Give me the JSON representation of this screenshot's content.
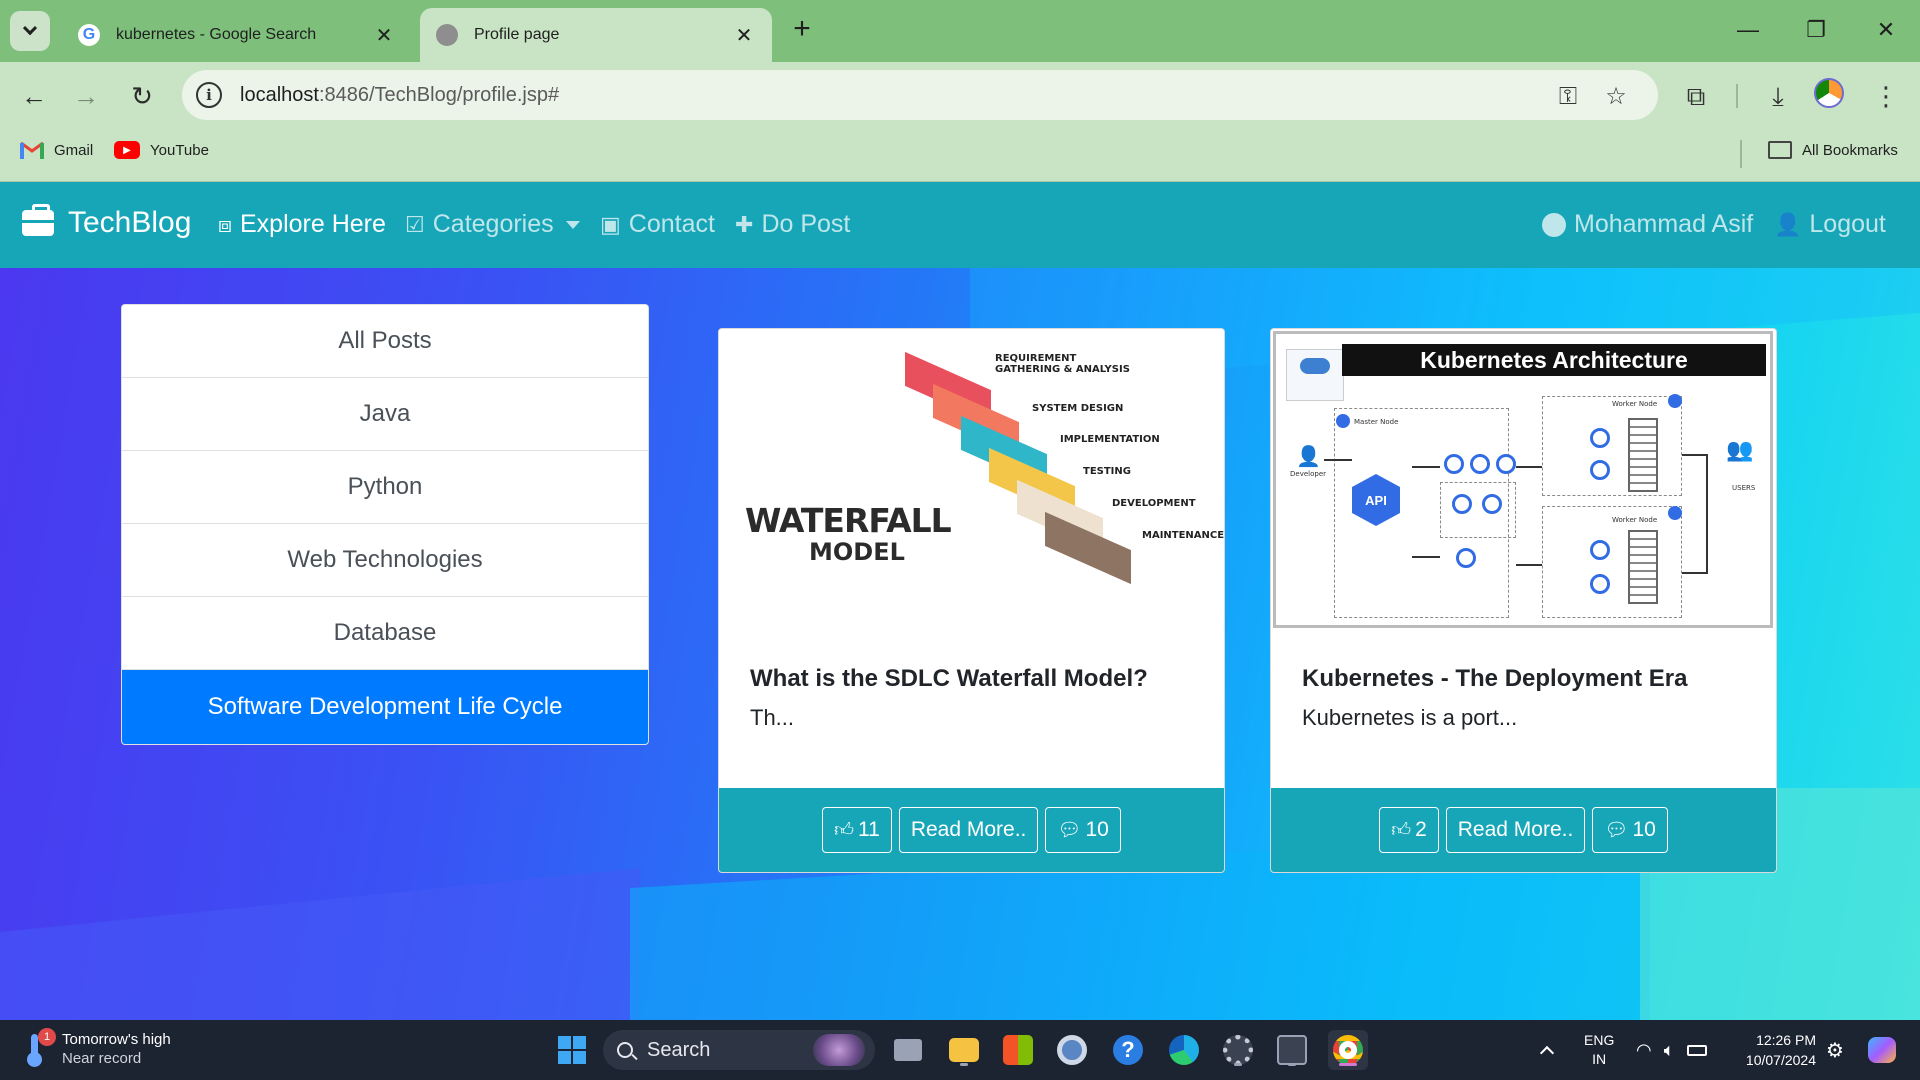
{
  "browser": {
    "tabs": [
      {
        "title": "kubernetes - Google Search",
        "favicon": "google-icon",
        "active": false
      },
      {
        "title": "Profile page",
        "favicon": "globe-icon",
        "active": true
      }
    ],
    "url_host": "localhost",
    "url_rest": ":8486/TechBlog/profile.jsp#",
    "bookmarks": [
      {
        "label": "Gmail",
        "icon": "gmail-icon"
      },
      {
        "label": "YouTube",
        "icon": "youtube-icon"
      }
    ],
    "all_bookmarks_label": "All Bookmarks"
  },
  "navbar": {
    "brand": "TechBlog",
    "items": [
      {
        "label": "Explore Here",
        "icon": "play-square-icon"
      },
      {
        "label": "Categories",
        "icon": "check-square-icon"
      },
      {
        "label": "Contact",
        "icon": "contact-book-icon"
      },
      {
        "label": "Do Post",
        "icon": "plus-icon"
      }
    ],
    "user": "Mohammad Asif",
    "logout": "Logout"
  },
  "categories": {
    "items": [
      "All Posts",
      "Java",
      "Python",
      "Web Technologies",
      "Database",
      "Software Development Life Cycle"
    ],
    "active_index": 5
  },
  "posts": [
    {
      "title": "What is the SDLC Waterfall Model?",
      "excerpt": "Th...",
      "likes": "11",
      "read_more": "Read More..",
      "comments": "10",
      "image": {
        "heading_line1": "WATERFALL",
        "heading_line2": "MODEL",
        "steps": [
          "REQUIREMENT GATHERING & ANALYSIS",
          "SYSTEM DESIGN",
          "IMPLEMENTATION",
          "TESTING",
          "DEVELOPMENT",
          "MAINTENANCE"
        ],
        "step_colors": [
          "#e9505e",
          "#f2795f",
          "#2fb6c8",
          "#f3c64a",
          "#efe1cf",
          "#8d7463"
        ]
      }
    },
    {
      "title": "Kubernetes - The Deployment Era",
      "excerpt": "Kubernetes is a port...",
      "likes": "2",
      "read_more": "Read More..",
      "comments": "10",
      "image": {
        "heading": "Kubernetes Architecture",
        "api_label": "API",
        "developer_label": "Developer",
        "users_label": "USERS",
        "master_label": "Master Node",
        "worker_label": "Worker Node"
      }
    }
  ],
  "taskbar": {
    "weather_line1": "Tomorrow's high",
    "weather_line2": "Near record",
    "weather_badge": "1",
    "search_placeholder": "Search",
    "lang_line1": "ENG",
    "lang_line2": "IN",
    "time": "12:26 PM",
    "date": "10/07/2024"
  },
  "colors": {
    "navbar": "#17a6b8",
    "active_category": "#007bff",
    "tab_strip": "#7dbf7b"
  }
}
